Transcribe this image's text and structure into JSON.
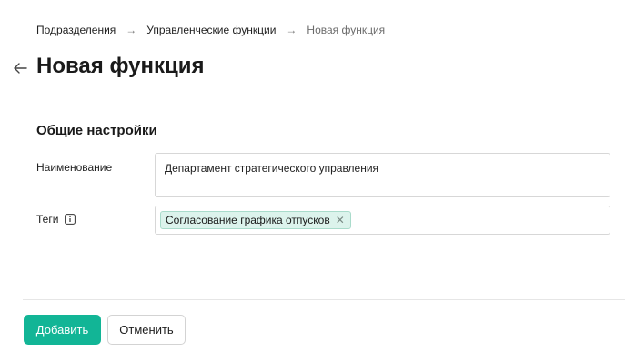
{
  "breadcrumb": {
    "items": [
      "Подразделения",
      "Управленческие функции",
      "Новая функция"
    ]
  },
  "header": {
    "title": "Новая функция"
  },
  "section": {
    "title": "Общие настройки"
  },
  "form": {
    "name_label": "Наименование",
    "name_value": "Департамент стратегического управления",
    "tags_label": "Теги",
    "tags": [
      "Согласование графика отпусков"
    ]
  },
  "actions": {
    "add_label": "Добавить",
    "cancel_label": "Отменить"
  },
  "colors": {
    "accent": "#12b596",
    "tag_background": "#dcf3ec"
  }
}
